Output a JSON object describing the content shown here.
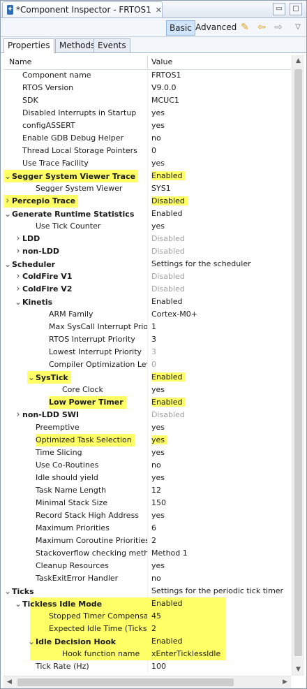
{
  "window": {
    "title": "*Component Inspector - FRTOS1",
    "close": "✕",
    "minimize": "▭",
    "maximize": "□"
  },
  "toolbar": {
    "basic_label": "Basic",
    "advanced_label": "Advanced"
  },
  "tabs": [
    "Properties",
    "Methods",
    "Events"
  ],
  "columns": {
    "name": "Name",
    "value": "Value"
  },
  "colors": {
    "highlight": "#ffff66",
    "selected_button": "#cfe4f8"
  },
  "rows": [
    {
      "name": "Component name",
      "value": "FRTOS1",
      "level": 1
    },
    {
      "name": "RTOS Version",
      "value": "V9.0.0",
      "level": 1
    },
    {
      "name": "SDK",
      "value": "MCUC1",
      "level": 1
    },
    {
      "name": "Disabled Interrupts in Startup",
      "value": "yes",
      "level": 1
    },
    {
      "name": "configASSERT",
      "value": "yes",
      "level": 1
    },
    {
      "name": "Enable GDB Debug Helper",
      "value": "no",
      "level": 1
    },
    {
      "name": "Thread Local Storage Pointers",
      "value": "0",
      "level": 1
    },
    {
      "name": "Use Trace Facility",
      "value": "yes",
      "level": 1
    },
    {
      "name": "Segger System Viewer Trace",
      "value": "Enabled",
      "level": 0,
      "twisty": "open",
      "bold": true,
      "hl": "both"
    },
    {
      "name": "Segger System Viewer",
      "value": "SYS1",
      "level": 2
    },
    {
      "name": "Percepio Trace",
      "value": "Disabled",
      "level": 0,
      "twisty": "closed",
      "bold": true,
      "hl": "both"
    },
    {
      "name": "Generate Runtime Statistics",
      "value": "Enabled",
      "level": 0,
      "twisty": "open",
      "bold": true
    },
    {
      "name": "Use Tick Counter",
      "value": "yes",
      "level": 2
    },
    {
      "name": "LDD",
      "value": "Disabled",
      "level": 1,
      "twisty": "closed",
      "bold": true,
      "dis": true
    },
    {
      "name": "non-LDD",
      "value": "Disabled",
      "level": 1,
      "twisty": "closed",
      "bold": true,
      "dis": true
    },
    {
      "name": "Scheduler",
      "value": "Settings for the scheduler",
      "level": 0,
      "twisty": "open",
      "bold": true
    },
    {
      "name": "ColdFire V1",
      "value": "Disabled",
      "level": 1,
      "twisty": "closed",
      "bold": true,
      "dis": true
    },
    {
      "name": "ColdFire V2",
      "value": "Disabled",
      "level": 1,
      "twisty": "closed",
      "bold": true,
      "dis": true
    },
    {
      "name": "Kinetis",
      "value": "Enabled",
      "level": 1,
      "twisty": "open",
      "bold": true
    },
    {
      "name": "ARM Family",
      "value": "Cortex-M0+",
      "level": 3
    },
    {
      "name": "Max SysCall Interrupt Priori",
      "value": "1",
      "level": 3
    },
    {
      "name": "RTOS Interrupt Priority",
      "value": "3",
      "level": 3
    },
    {
      "name": "Lowest Interrupt Priority",
      "value": "3",
      "level": 3,
      "dis": true
    },
    {
      "name": "Compiler Optimization Lev",
      "value": "0",
      "level": 3,
      "dis": true
    },
    {
      "name": "SysTick",
      "value": "Enabled",
      "level": 2,
      "twisty": "open",
      "bold": true,
      "hl": "both"
    },
    {
      "name": "Core Clock",
      "value": "yes",
      "level": 4
    },
    {
      "name": "Low Power Timer",
      "value": "Enabled",
      "level": 3,
      "bold": true,
      "hl": "both"
    },
    {
      "name": "non-LDD SWI",
      "value": "Disabled",
      "level": 1,
      "twisty": "closed",
      "bold": true,
      "dis": true
    },
    {
      "name": "Preemptive",
      "value": "yes",
      "level": 2
    },
    {
      "name": "Optimized Task Selection",
      "value": "yes",
      "level": 2,
      "hl": "both"
    },
    {
      "name": "Time Slicing",
      "value": "yes",
      "level": 2
    },
    {
      "name": "Use Co-Routines",
      "value": "no",
      "level": 2
    },
    {
      "name": "Idle should yield",
      "value": "yes",
      "level": 2
    },
    {
      "name": "Task Name Length",
      "value": "12",
      "level": 2
    },
    {
      "name": "Minimal Stack Size",
      "value": "150",
      "level": 2
    },
    {
      "name": "Record Stack High Address",
      "value": "yes",
      "level": 2
    },
    {
      "name": "Maximum Priorities",
      "value": "6",
      "level": 2
    },
    {
      "name": "Maximum Coroutine Priorities",
      "value": "2",
      "level": 2
    },
    {
      "name": "Stackoverflow checking metho",
      "value": "Method 1",
      "level": 2
    },
    {
      "name": "Cleanup Resources",
      "value": "yes",
      "level": 2
    },
    {
      "name": "TaskExitError Handler",
      "value": "no",
      "level": 2
    },
    {
      "name": "Ticks",
      "value": "Settings for the periodic tick timer",
      "level": 0,
      "twisty": "open",
      "bold": true
    },
    {
      "name": "Tickless Idle Mode",
      "value": "Enabled",
      "level": 1,
      "twisty": "open",
      "bold": true,
      "hl": "block"
    },
    {
      "name": "Stopped Timer Compensat",
      "value": "45",
      "level": 3,
      "hl": "block"
    },
    {
      "name": "Expected Idle Time (Ticks)",
      "value": "2",
      "level": 3,
      "hl": "block"
    },
    {
      "name": "Idle Decision Hook",
      "value": "Enabled",
      "level": 2,
      "twisty": "open",
      "bold": true,
      "hl": "block"
    },
    {
      "name": "Hook function name",
      "value": "xEnterTicklessIdle",
      "level": 4,
      "hl": "block"
    },
    {
      "name": "Tick Rate (Hz)",
      "value": "100",
      "level": 2
    }
  ]
}
